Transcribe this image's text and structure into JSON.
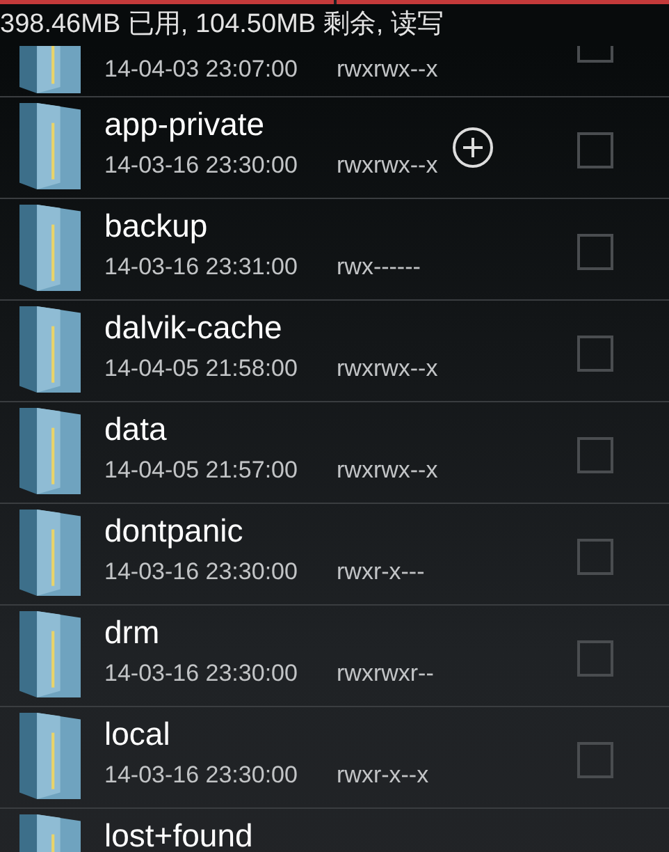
{
  "status_text": "398.46MB 已用, 104.50MB 剩余, 读写",
  "rows": [
    {
      "date": "14-04-03 23:07:00",
      "permissions": "rwxrwx--x",
      "add_button": false,
      "checked": false
    },
    {
      "name": "app-private",
      "date": "14-03-16 23:30:00",
      "permissions": "rwxrwx--x",
      "add_button": true,
      "checked": false
    },
    {
      "name": "backup",
      "date": "14-03-16 23:31:00",
      "permissions": "rwx------",
      "add_button": false,
      "checked": false
    },
    {
      "name": "dalvik-cache",
      "date": "14-04-05 21:58:00",
      "permissions": "rwxrwx--x",
      "add_button": false,
      "checked": false
    },
    {
      "name": "data",
      "date": "14-04-05 21:57:00",
      "permissions": "rwxrwx--x",
      "add_button": false,
      "checked": false
    },
    {
      "name": "dontpanic",
      "date": "14-03-16 23:30:00",
      "permissions": "rwxr-x---",
      "add_button": false,
      "checked": false
    },
    {
      "name": "drm",
      "date": "14-03-16 23:30:00",
      "permissions": "rwxrwxr--",
      "add_button": false,
      "checked": false
    },
    {
      "name": "local",
      "date": "14-03-16 23:30:00",
      "permissions": "rwxr-x--x",
      "add_button": false,
      "checked": false
    },
    {
      "name": "lost+found",
      "add_button": false
    }
  ]
}
